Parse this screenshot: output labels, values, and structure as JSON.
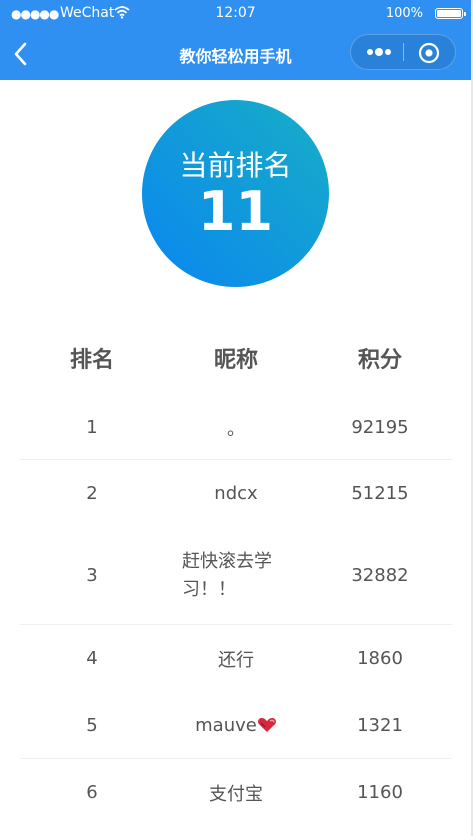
{
  "status": {
    "signal": "●●●●●",
    "carrier": "WeChat",
    "wifi_icon": "wifi-icon",
    "time": "12:07",
    "battery": "100%"
  },
  "nav": {
    "back_icon": "chevron-left-icon",
    "title": "教你轻松用手机",
    "more_icon": "more-dots-icon",
    "close_icon": "record-circle-icon"
  },
  "rank": {
    "label": "当前排名",
    "value": "11"
  },
  "table": {
    "headers": [
      "排名",
      "昵称",
      "积分"
    ],
    "rows": [
      {
        "rank": "1",
        "name": "。",
        "score": "92195"
      },
      {
        "rank": "2",
        "name": "ndcx",
        "score": "51215"
      },
      {
        "rank": "3",
        "name": "赶快滚去学习！！",
        "score": "32882"
      },
      {
        "rank": "4",
        "name": "还行",
        "score": "1860"
      },
      {
        "rank": "5",
        "name": "mauve",
        "name_icon": "heart-emoji-icon",
        "score": "1321"
      },
      {
        "rank": "6",
        "name": "支付宝",
        "score": "1160"
      }
    ]
  },
  "colors": {
    "brand": "#2f90f2",
    "circle_start": "#0a86f0",
    "circle_end": "#18aec6",
    "text": "#555555"
  }
}
